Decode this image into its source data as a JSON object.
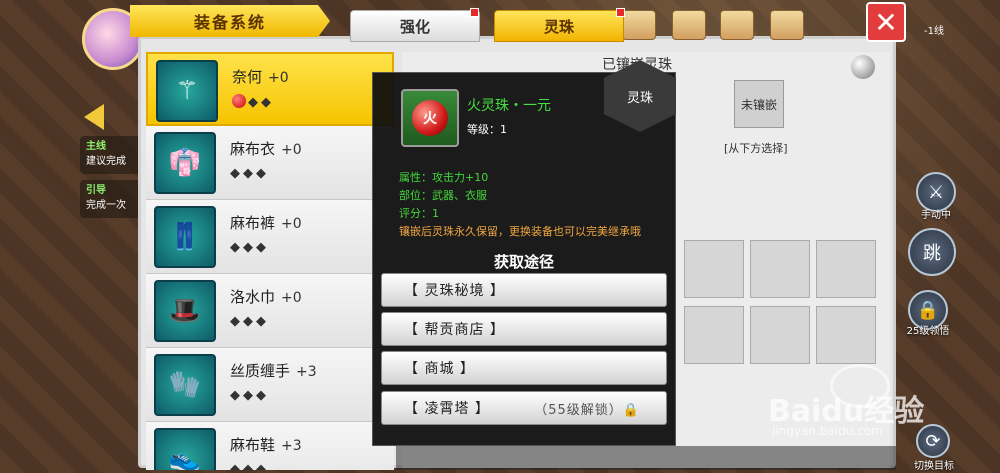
{
  "window": {
    "title": "装备系统"
  },
  "tabs": [
    {
      "label": "强化",
      "active": false
    },
    {
      "label": "灵珠",
      "active": true
    }
  ],
  "hud": {
    "status": "-1线",
    "quests": [
      {
        "title": "主线",
        "text": "建议完成"
      },
      {
        "title": "引导",
        "text": "完成一次"
      }
    ],
    "manual_label": "手动中",
    "lock_label": "25级领悟",
    "switch_label": "切换目标"
  },
  "equipment": [
    {
      "name": "奈何",
      "level": "+0",
      "slots": "◆◆",
      "has_gem": true,
      "icon": "staff-icon"
    },
    {
      "name": "麻布衣",
      "level": "+0",
      "slots": "◆◆◆",
      "has_gem": false,
      "icon": "robe-icon"
    },
    {
      "name": "麻布裤",
      "level": "+0",
      "slots": "◆◆◆",
      "has_gem": false,
      "icon": "pants-icon"
    },
    {
      "name": "洛水巾",
      "level": "+0",
      "slots": "◆◆◆",
      "has_gem": false,
      "icon": "hat-icon"
    },
    {
      "name": "丝质缠手",
      "level": "+3",
      "slots": "◆◆◆",
      "has_gem": false,
      "icon": "gloves-icon"
    },
    {
      "name": "麻布鞋",
      "level": "+3",
      "slots": "◆◆◆",
      "has_gem": false,
      "icon": "shoes-icon"
    }
  ],
  "mount_panel": {
    "header": "已镶嵌灵珠",
    "hex_label": "灵珠",
    "unmounted": "未镶嵌",
    "choose_below": "[从下方选择]"
  },
  "popup": {
    "gem_glyph": "火",
    "gem_name": "火灵珠・一元",
    "gem_level": "等级：1",
    "attributes": [
      {
        "label": "属性：",
        "value": "攻击力+10"
      },
      {
        "label": "部位：",
        "value": "武器、衣服"
      },
      {
        "label": "评分：",
        "value": "1"
      }
    ],
    "note": "镶嵌后灵珠永久保留，更换装备也可以完美继承哦",
    "acquire_title": "获取途径",
    "acquire_options": [
      {
        "label": "【 灵珠秘境 】",
        "lock": ""
      },
      {
        "label": "【 帮贡商店 】",
        "lock": ""
      },
      {
        "label": "【 商城 】",
        "lock": ""
      },
      {
        "label": "【 凌霄塔 】",
        "lock": "（55级解锁）🔒"
      }
    ]
  },
  "watermark": {
    "text": "Baidu经验",
    "url": "jingyan.baidu.com"
  },
  "colors": {
    "accent": "#f6c400",
    "close": "#e33c3c",
    "gem_green": "#43e040",
    "warn": "#f0a640"
  }
}
